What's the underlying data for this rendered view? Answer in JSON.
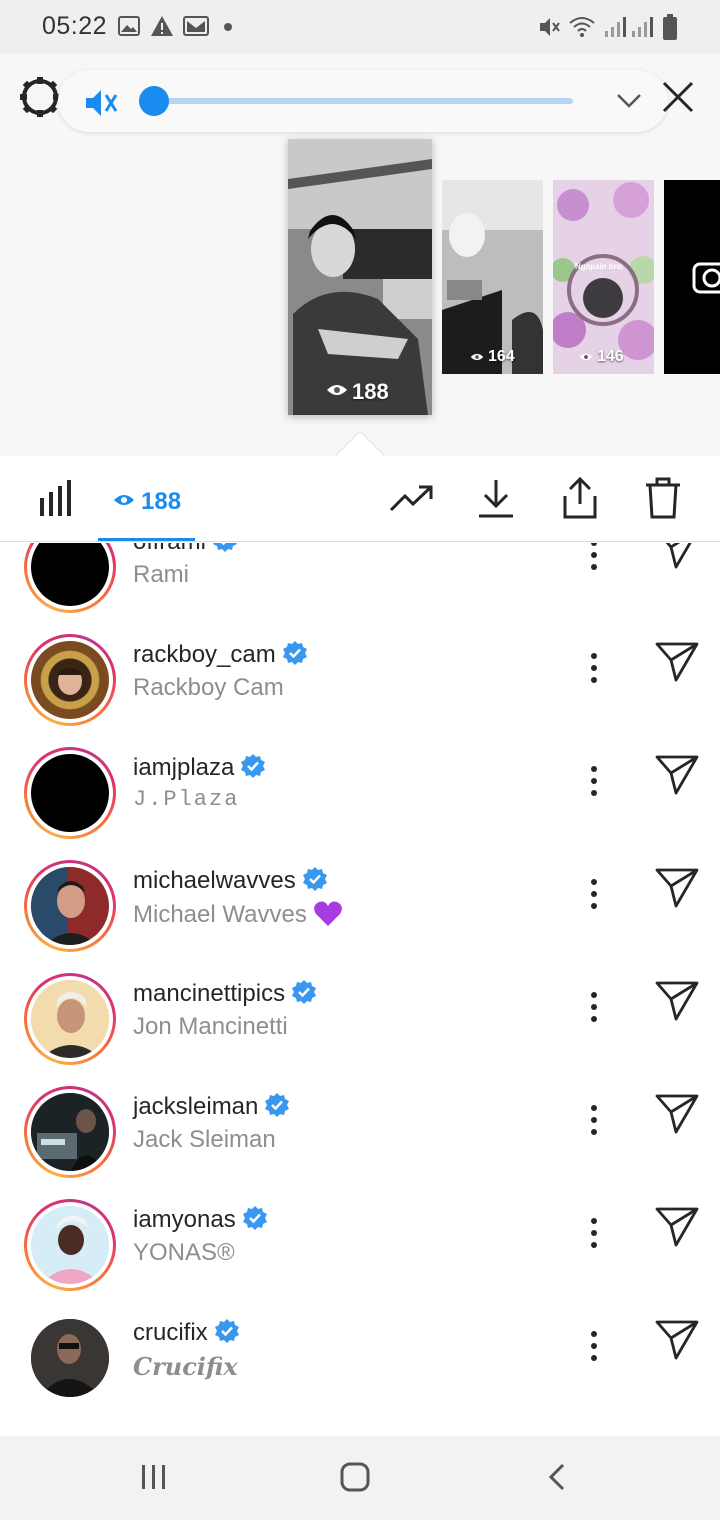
{
  "status_bar": {
    "time": "05:22",
    "left_icons": [
      "image-icon",
      "warning-icon",
      "gmail-icon",
      "dot-icon"
    ],
    "right_icons": [
      "mute-icon",
      "wifi-icon",
      "signal-icon",
      "signal-icon",
      "battery-icon"
    ]
  },
  "player": {
    "settings_icon": "gear-icon",
    "mute_icon": "muted-speaker-icon",
    "progress": 0.0,
    "collapse_icon": "chevron-down-icon",
    "close_icon": "close-icon"
  },
  "stories": [
    {
      "views": "188",
      "selected": true
    },
    {
      "views": "164",
      "selected": false
    },
    {
      "views": "146",
      "caption": "Ngapain bro.",
      "selected": false
    },
    {
      "views": "",
      "selected": false,
      "icon": "camera-icon"
    }
  ],
  "toolbar": {
    "insights_icon": "bar-chart-icon",
    "views_icon": "eye-icon",
    "views_count": "188",
    "actions": [
      "trending-icon",
      "download-icon",
      "share-icon",
      "trash-icon"
    ]
  },
  "viewers": [
    {
      "username": "offrami",
      "full_name": "Rami",
      "verified": true
    },
    {
      "username": "rackboy_cam",
      "full_name": "Rackboy Cam",
      "verified": true
    },
    {
      "username": "iamjplaza",
      "full_name": "J.Plaza",
      "verified": true
    },
    {
      "username": "michaelwavves",
      "full_name": "Michael Wavves",
      "verified": true,
      "emoji": "purple-heart"
    },
    {
      "username": "mancinettipics",
      "full_name": "Jon Mancinetti",
      "verified": true
    },
    {
      "username": "jacksleiman",
      "full_name": "Jack Sleiman",
      "verified": true
    },
    {
      "username": "iamyonas",
      "full_name": "YONAS®",
      "verified": true
    },
    {
      "username": "crucifix",
      "full_name": "Crucifix",
      "verified": true
    }
  ],
  "nav_bar": {
    "buttons": [
      "recents-icon",
      "home-icon",
      "back-icon"
    ]
  },
  "colors": {
    "accent": "#1a8cf0",
    "verified": "#3897f0",
    "text_primary": "#262626",
    "text_secondary": "#8e8e8e"
  }
}
